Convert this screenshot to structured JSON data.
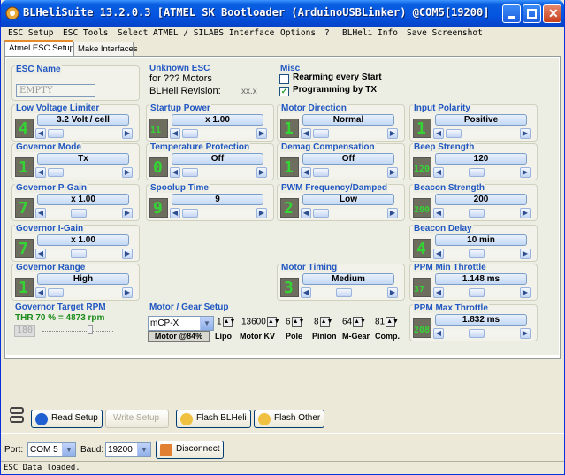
{
  "window": {
    "title": "BLHeliSuite 13.2.0.3  [ATMEL SK Bootloader (ArduinoUSBLinker) @COM5[19200]"
  },
  "menu": [
    "ESC Setup",
    "ESC Tools",
    "Select ATMEL / SILABS Interface",
    "Options",
    "?",
    "BLHeli Info",
    "Save Screenshot"
  ],
  "tabs": [
    "Atmel ESC Setup",
    "Make Interfaces"
  ],
  "esc_name": {
    "title": "ESC Name",
    "value": "EMPTY"
  },
  "unknown_esc": {
    "title": "Unknown ESC",
    "line1": "for ??? Motors",
    "line2_label": "BLHeli Revision:",
    "line2_value": "xx.x"
  },
  "misc": {
    "title": "Misc",
    "rearming": "Rearming every Start",
    "programming": "Programming by TX"
  },
  "groups": {
    "low_voltage": {
      "title": "Low Voltage Limiter",
      "value": "3.2 Volt / cell",
      "lcd": "4"
    },
    "startup_power": {
      "title": "Startup Power",
      "value": "x 1.00",
      "lcd": "11"
    },
    "motor_direction": {
      "title": "Motor Direction",
      "value": "Normal",
      "lcd": "1"
    },
    "input_polarity": {
      "title": "Input Polarity",
      "value": "Positive",
      "lcd": "1"
    },
    "governor_mode": {
      "title": "Governor Mode",
      "value": "Tx",
      "lcd": "1"
    },
    "temp_protection": {
      "title": "Temperature Protection",
      "value": "Off",
      "lcd": "0"
    },
    "demag": {
      "title": "Demag Compensation",
      "value": "Off",
      "lcd": "1"
    },
    "beep": {
      "title": "Beep Strength",
      "value": "120",
      "lcd": "120"
    },
    "gov_p": {
      "title": "Governor P-Gain",
      "value": "x 1.00",
      "lcd": "7"
    },
    "spoolup": {
      "title": "Spoolup Time",
      "value": "9",
      "lcd": "9"
    },
    "pwm": {
      "title": "PWM Frequency/Damped",
      "value": "Low",
      "lcd": "2"
    },
    "beacon_strength": {
      "title": "Beacon Strength",
      "value": "200",
      "lcd": "200"
    },
    "gov_i": {
      "title": "Governor I-Gain",
      "value": "x 1.00",
      "lcd": "7"
    },
    "beacon_delay": {
      "title": "Beacon Delay",
      "value": "10 min",
      "lcd": "4"
    },
    "gov_range": {
      "title": "Governor Range",
      "value": "High",
      "lcd": "1"
    },
    "motor_timing": {
      "title": "Motor Timing",
      "value": "Medium",
      "lcd": "3"
    },
    "ppm_min": {
      "title": "PPM Min Throttle",
      "value": "1.148 ms",
      "lcd": "37"
    },
    "ppm_max": {
      "title": "PPM Max Throttle",
      "value": "1.832 ms",
      "lcd": "208"
    }
  },
  "gov_target": {
    "title": "Governor Target RPM",
    "text": "THR 70 % = 4873 rpm",
    "lcd": "180"
  },
  "motor_gear": {
    "title": "Motor / Gear Setup",
    "model": "mCP-X",
    "lipo": "1",
    "kv": "13600",
    "pole": "6",
    "pinion": "8",
    "mgear": "64",
    "comp": "81",
    "motor_pct": "Motor @84%",
    "labels": [
      "Lipo",
      "Motor KV",
      "Pole",
      "Pinion",
      "M-Gear",
      "Comp."
    ]
  },
  "buttons": {
    "read": "Read Setup",
    "write": "Write Setup",
    "flash_blheli": "Flash BLHeli",
    "flash_other": "Flash Other",
    "disconnect": "Disconnect"
  },
  "port": {
    "label": "Port:",
    "value": "COM 5",
    "baud_label": "Baud:",
    "baud": "19200"
  },
  "status": "ESC Data loaded."
}
